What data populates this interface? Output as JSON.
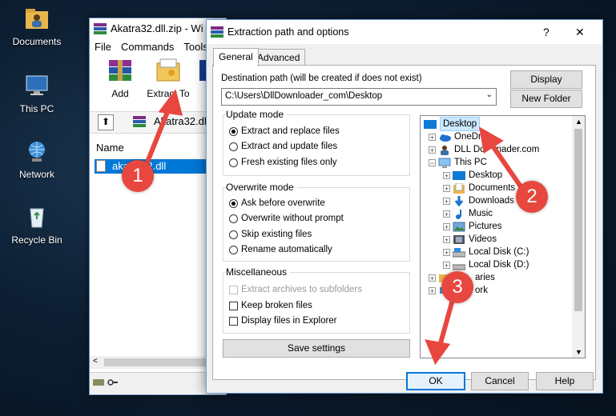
{
  "desktop": {
    "icons": [
      {
        "label": "Documents"
      },
      {
        "label": "This PC"
      },
      {
        "label": "Network"
      },
      {
        "label": "Recycle Bin"
      }
    ]
  },
  "winrar": {
    "title": "Akatra32.dll.zip - Wi",
    "menu": [
      "File",
      "Commands",
      "Tools"
    ],
    "toolbar": {
      "add": "Add",
      "extract_to": "Extract To"
    },
    "path_text": "Akatra32.dl",
    "column_name": "Name",
    "file_item": "akatra32.dll"
  },
  "dialog": {
    "title": "Extraction path and options",
    "help_glyph": "?",
    "close_glyph": "✕",
    "tabs": {
      "general": "General",
      "advanced": "Advanced"
    },
    "destination_label": "Destination path (will be created if does not exist)",
    "destination_value": "C:\\Users\\DllDownloader_com\\Desktop",
    "display_button": "Display",
    "new_folder_button": "New Folder",
    "update_mode": {
      "label": "Update mode",
      "options": [
        "Extract and replace files",
        "Extract and update files",
        "Fresh existing files only"
      ],
      "selected": 0
    },
    "overwrite_mode": {
      "label": "Overwrite mode",
      "options": [
        "Ask before overwrite",
        "Overwrite without prompt",
        "Skip existing files",
        "Rename automatically"
      ],
      "selected": 0
    },
    "misc": {
      "label": "Miscellaneous",
      "options": [
        "Extract archives to subfolders",
        "Keep broken files",
        "Display files in Explorer"
      ]
    },
    "save_settings_button": "Save settings",
    "tree": {
      "items": [
        "Desktop",
        "OneDr",
        "DLL Do",
        "nader.com",
        "This PC",
        "Desktop",
        "Documents",
        "Downloads",
        "Music",
        "Pictures",
        "Videos",
        "Local Disk (C:)",
        "Local Disk (D:)",
        "aries",
        "ork"
      ]
    },
    "ok_button": "OK",
    "cancel_button": "Cancel",
    "help_button": "Help"
  },
  "callouts": [
    "1",
    "2",
    "3"
  ],
  "colors": {
    "accent": "#0078d7",
    "callout": "#e8473f",
    "selection": "#cce8ff"
  }
}
